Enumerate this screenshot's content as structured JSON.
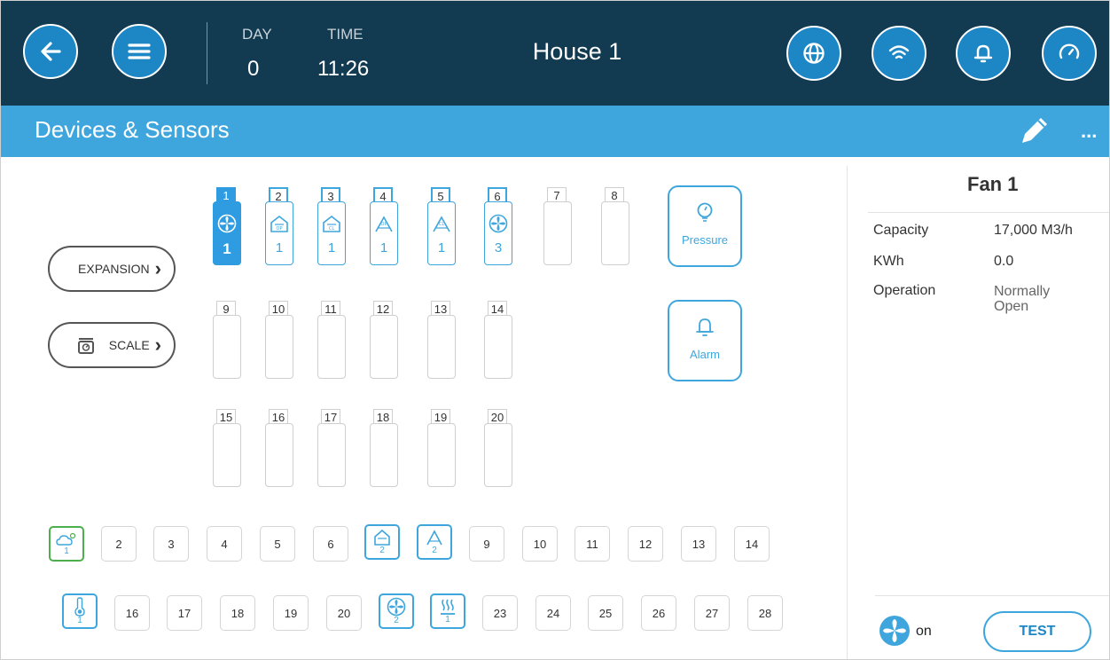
{
  "header": {
    "day_label": "DAY",
    "day_value": "0",
    "time_label": "TIME",
    "time_value": "11:26",
    "title": "House 1",
    "buttons": [
      "back-icon",
      "menu-icon",
      "globe-icon",
      "wifi-icon",
      "bell-icon",
      "gauge-icon"
    ]
  },
  "titlebar": {
    "title": "Devices & Sensors",
    "more": "..."
  },
  "left_buttons": {
    "expansion": "EXPANSION",
    "scale": "SCALE"
  },
  "relays": {
    "row1": [
      {
        "num": "1",
        "icon": "fan-icon",
        "sub": "1",
        "state": "selected"
      },
      {
        "num": "2",
        "icon": "inlet-open-icon",
        "sub": "1",
        "state": "used"
      },
      {
        "num": "3",
        "icon": "inlet-close-icon",
        "sub": "1",
        "state": "used"
      },
      {
        "num": "4",
        "icon": "tunnel-open-icon",
        "sub": "1",
        "state": "used"
      },
      {
        "num": "5",
        "icon": "tunnel-close-icon",
        "sub": "1",
        "state": "used"
      },
      {
        "num": "6",
        "icon": "fan-icon",
        "sub": "3",
        "state": "used"
      },
      {
        "num": "7",
        "icon": "",
        "sub": "",
        "state": "empty"
      },
      {
        "num": "8",
        "icon": "",
        "sub": "",
        "state": "empty"
      }
    ],
    "row2": [
      "9",
      "10",
      "11",
      "12",
      "13",
      "14"
    ],
    "row3": [
      "15",
      "16",
      "17",
      "18",
      "19",
      "20"
    ]
  },
  "cards": {
    "pressure": "Pressure",
    "alarm": "Alarm"
  },
  "inputs": {
    "row1": [
      {
        "num": "1",
        "icon": "weather-icon",
        "kind": "green"
      },
      {
        "num": "2"
      },
      {
        "num": "3"
      },
      {
        "num": "4"
      },
      {
        "num": "5"
      },
      {
        "num": "6"
      },
      {
        "num": "2",
        "icon": "inlet-icon",
        "kind": "used"
      },
      {
        "num": "2",
        "icon": "tunnel-icon",
        "kind": "used"
      },
      {
        "num": "9"
      },
      {
        "num": "10"
      },
      {
        "num": "11"
      },
      {
        "num": "12"
      },
      {
        "num": "13"
      },
      {
        "num": "14"
      }
    ],
    "row2": [
      {
        "num": "1",
        "icon": "thermometer-icon",
        "kind": "used"
      },
      {
        "num": "16"
      },
      {
        "num": "17"
      },
      {
        "num": "18"
      },
      {
        "num": "19"
      },
      {
        "num": "20"
      },
      {
        "num": "2",
        "icon": "fan-icon",
        "kind": "used"
      },
      {
        "num": "1",
        "icon": "heater-icon",
        "kind": "used"
      },
      {
        "num": "23"
      },
      {
        "num": "24"
      },
      {
        "num": "25"
      },
      {
        "num": "26"
      },
      {
        "num": "27"
      },
      {
        "num": "28"
      }
    ]
  },
  "details": {
    "title": "Fan 1",
    "capacity_label": "Capacity",
    "capacity_value": "17,000 M3/h",
    "kwh_label": "KWh",
    "kwh_value": "0.0",
    "operation_label": "Operation",
    "operation_value": "Normally Open",
    "status": "on",
    "test": "TEST"
  },
  "colors": {
    "header": "#123a51",
    "accent": "#3ea6dc",
    "button": "#1d87c5",
    "green": "#4cae4c"
  }
}
